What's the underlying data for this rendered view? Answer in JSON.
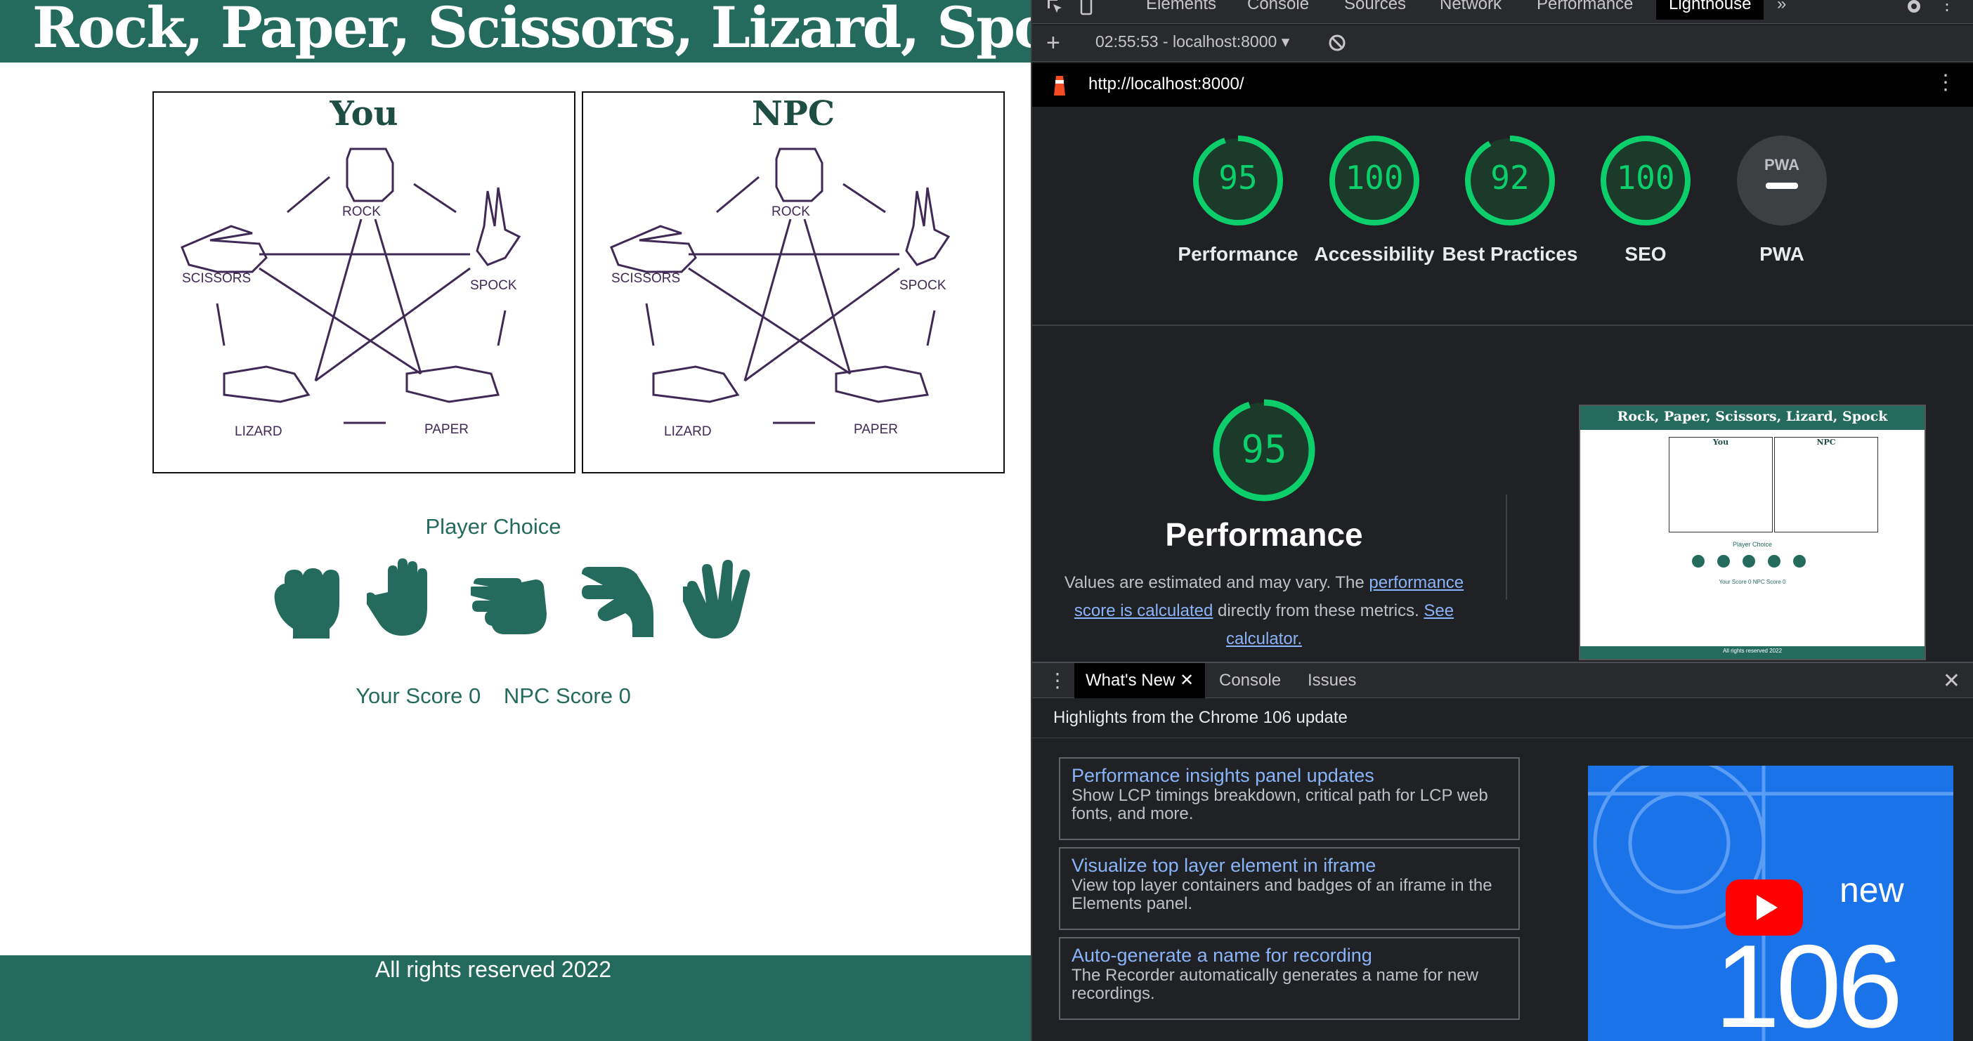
{
  "game": {
    "title": "Rock, Paper, Scissors, Lizard, Spock",
    "boards": [
      {
        "label": "You"
      },
      {
        "label": "NPC"
      }
    ],
    "diagram_labels": {
      "rock": "ROCK",
      "scissors": "SCISSORS",
      "spock": "SPOCK",
      "lizard": "LIZARD",
      "paper": "PAPER"
    },
    "player_choice_label": "Player Choice",
    "choices": [
      "rock-hand-icon",
      "paper-hand-icon",
      "scissors-hand-icon",
      "lizard-hand-icon",
      "spock-hand-icon"
    ],
    "scores": {
      "you": "Your Score 0",
      "npc": "NPC Score 0"
    },
    "footer": "All rights reserved 2022",
    "colors": {
      "brand": "#246b5e",
      "diagram": "#3f2a55"
    }
  },
  "devtools": {
    "tabs": [
      "Elements",
      "Console",
      "Sources",
      "Network",
      "Performance",
      "Lighthouse"
    ],
    "active_tab": "Lighthouse",
    "report_selector": "02:55:53 - localhost:8000",
    "url": "http://localhost:8000/",
    "scores": [
      {
        "label": "Performance",
        "value": "95"
      },
      {
        "label": "Accessibility",
        "value": "100"
      },
      {
        "label": "Best Practices",
        "value": "92"
      },
      {
        "label": "SEO",
        "value": "100"
      },
      {
        "label": "PWA",
        "value": "PWA"
      }
    ],
    "performance": {
      "value": "95",
      "title": "Performance",
      "desc_1": "Values are estimated and may vary. The ",
      "link_1": "performance score is calculated",
      "desc_2": " directly from these metrics. ",
      "link_2": "See calculator."
    },
    "drawer": {
      "tabs": [
        "What's New",
        "Console",
        "Issues"
      ],
      "headline": "Highlights from the Chrome 106 update",
      "news": [
        {
          "title": "Performance insights panel updates",
          "body": "Show LCP timings breakdown, critical path for LCP web fonts, and more."
        },
        {
          "title": "Visualize top layer element in iframe",
          "body": "View top layer containers and badges of an iframe in the Elements panel."
        },
        {
          "title": "Auto-generate a name for recording",
          "body": "The Recorder automatically generates a name for new recordings."
        }
      ],
      "video": {
        "new": "new",
        "version": "106"
      }
    },
    "colors": {
      "pass": "#0cce6b",
      "link": "#8ab4f8"
    }
  }
}
